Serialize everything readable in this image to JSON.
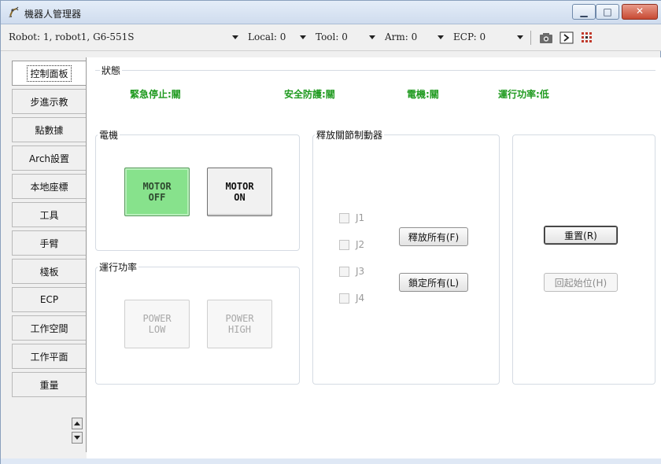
{
  "window": {
    "title": "機器人管理器"
  },
  "toolbar": {
    "robot": "Robot: 1, robot1, G6-551S",
    "local": "Local: 0",
    "tool": "Tool: 0",
    "arm": "Arm: 0",
    "ecp": "ECP: 0"
  },
  "tabs": [
    "控制面板",
    "步進示教",
    "點數據",
    "Arch設置",
    "本地座標",
    "工具",
    "手臂",
    "棧板",
    "ECP",
    "工作空間",
    "工作平面",
    "重量"
  ],
  "status": {
    "title": "狀態",
    "estop": "緊急停止:關",
    "safeguard": "安全防護:關",
    "motor": "電機:關",
    "power": "運行功率:低"
  },
  "motor_group": {
    "title": "電機",
    "off_line1": "MOTOR",
    "off_line2": "OFF",
    "on_line1": "MOTOR",
    "on_line2": "ON"
  },
  "power_group": {
    "title": "運行功率",
    "low_line1": "POWER",
    "low_line2": "LOW",
    "high_line1": "POWER",
    "high_line2": "HIGH"
  },
  "brake_group": {
    "title": "釋放關節制動器",
    "joints": [
      "J1",
      "J2",
      "J3",
      "J4"
    ],
    "release_all": "釋放所有(F)",
    "lock_all": "鎖定所有(L)"
  },
  "actions": {
    "reset": "重置(R)",
    "home": "回起始位(H)"
  },
  "colors": {
    "status_green": "#1f9a1f",
    "motor_off_bg": "#87e28c"
  }
}
